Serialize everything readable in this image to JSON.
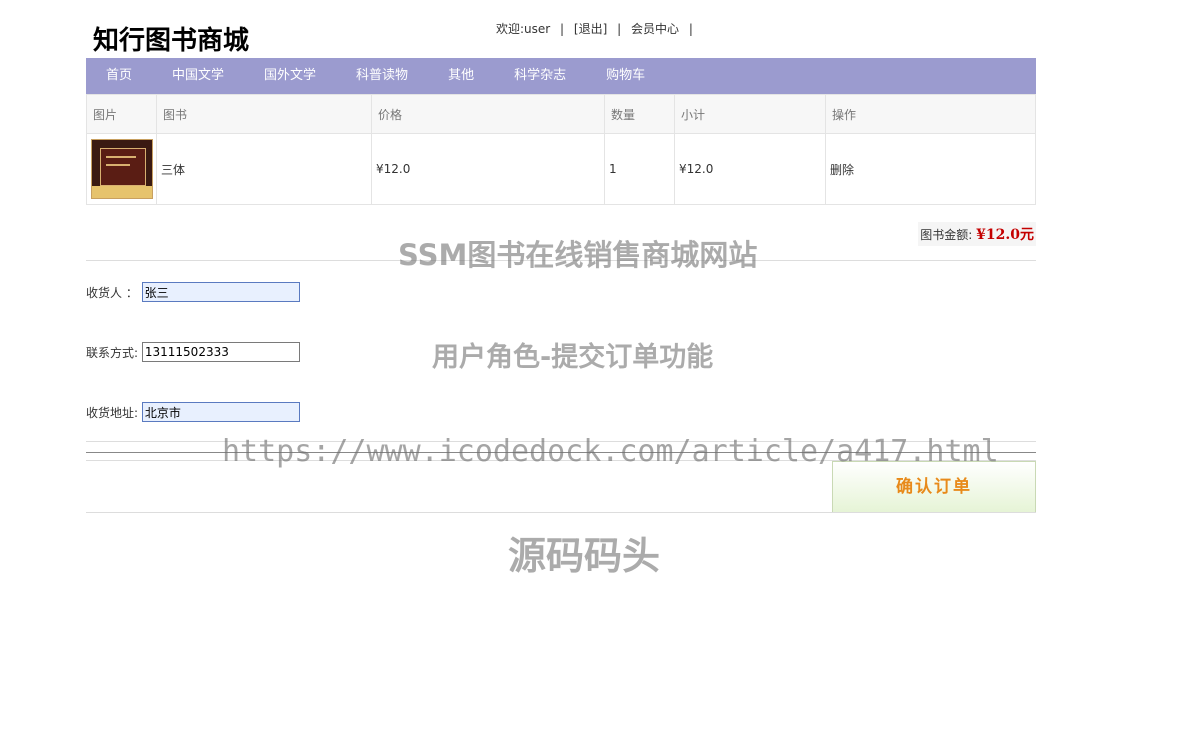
{
  "site": {
    "title": "知行图书商城"
  },
  "topbar": {
    "welcome": "欢迎:user",
    "logout": "[退出]",
    "member": "会员中心",
    "sep": "|"
  },
  "nav": {
    "items": [
      "首页",
      "中国文学",
      "国外文学",
      "科普读物",
      "其他",
      "科学杂志",
      "购物车"
    ]
  },
  "cart": {
    "headers": [
      "图片",
      "图书",
      "价格",
      "数量",
      "小计",
      "操作"
    ],
    "rows": [
      {
        "book": "三体",
        "price": "¥12.0",
        "qty": "1",
        "subtotal": "¥12.0",
        "action": "删除"
      }
    ]
  },
  "total": {
    "label": "图书金额:",
    "value": "¥12.0元"
  },
  "form": {
    "receiver_label": "收货人 ：",
    "receiver_value": "张三",
    "phone_label": "联系方式:",
    "phone_value": "13111502333",
    "address_label": "收货地址:",
    "address_value": "北京市"
  },
  "confirm_label": "确认订单",
  "watermarks": {
    "line1": "SSM图书在线销售商城网站",
    "line2": "用户角色-提交订单功能",
    "line3": "https://www.icodedock.com/article/a417.html",
    "line4": "源码码头"
  }
}
